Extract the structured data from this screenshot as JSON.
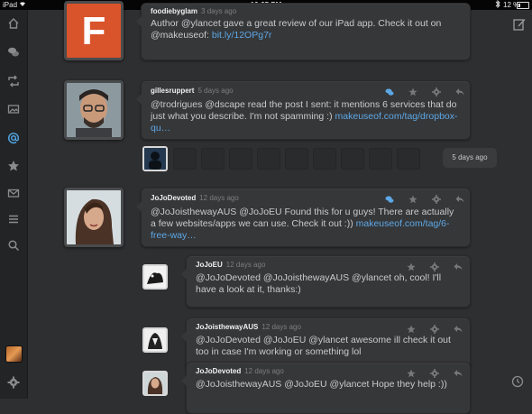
{
  "statusbar": {
    "carrier": "iPad",
    "time": "12:25 PM",
    "battery": "12 %"
  },
  "sidebar": {
    "items": [
      {
        "icon": "home-icon"
      },
      {
        "icon": "chat-bubbles-icon"
      },
      {
        "icon": "retweet-icon"
      },
      {
        "icon": "image-icon"
      },
      {
        "icon": "mentions-icon"
      },
      {
        "icon": "star-icon"
      },
      {
        "icon": "mail-icon"
      },
      {
        "icon": "list-icon"
      },
      {
        "icon": "search-icon"
      },
      {
        "icon": "settings-gear-icon"
      }
    ]
  },
  "tweets": [
    {
      "user": "foodiebyglam",
      "time": "3 days ago",
      "text": "Author @ylancet gave a great review of our iPad app. Check it out on @makeuseof:",
      "link": "bit.ly/12OPg7r",
      "avatar_letter": "F"
    },
    {
      "user": "gillesruppert",
      "time": "5 days ago",
      "text": "@trodrigues @dscape read the post I sent: it mentions 6 services that do just what you describe. I'm not spamming :)",
      "link": "makeuseof.com/tag/dropbox-qu…"
    },
    {
      "user": "JoJoDevoted",
      "time": "12 days ago",
      "text": "@JoJoisthewayAUS @JoJoEU Found this for u guys! There are actually a few websites/apps we can use. Check it out :))",
      "link": "makeuseof.com/tag/6-free-way…"
    },
    {
      "user": "JoJoEU",
      "time": "12 days ago",
      "text": "@JoJoDevoted @JoJoisthewayAUS @ylancet oh, cool! I'll have a look at it, thanks:)"
    },
    {
      "user": "JoJoisthewayAUS",
      "time": "12 days ago",
      "text": "@JoJoDevoted @JoJoEU @ylancet awesome ill check it out too in case I'm working or something lol"
    },
    {
      "user": "JoJoDevoted",
      "time": "12 days ago",
      "text": "@JoJoisthewayAUS @JoJoEU @ylancet Hope they help :))"
    }
  ],
  "gap": {
    "label": "5 days ago"
  },
  "colors": {
    "accent": "#5da8e6",
    "background": "#2e2f31",
    "sidebar": "#232426",
    "bubble": "#363739",
    "avatar_orange": "#d9532b"
  }
}
